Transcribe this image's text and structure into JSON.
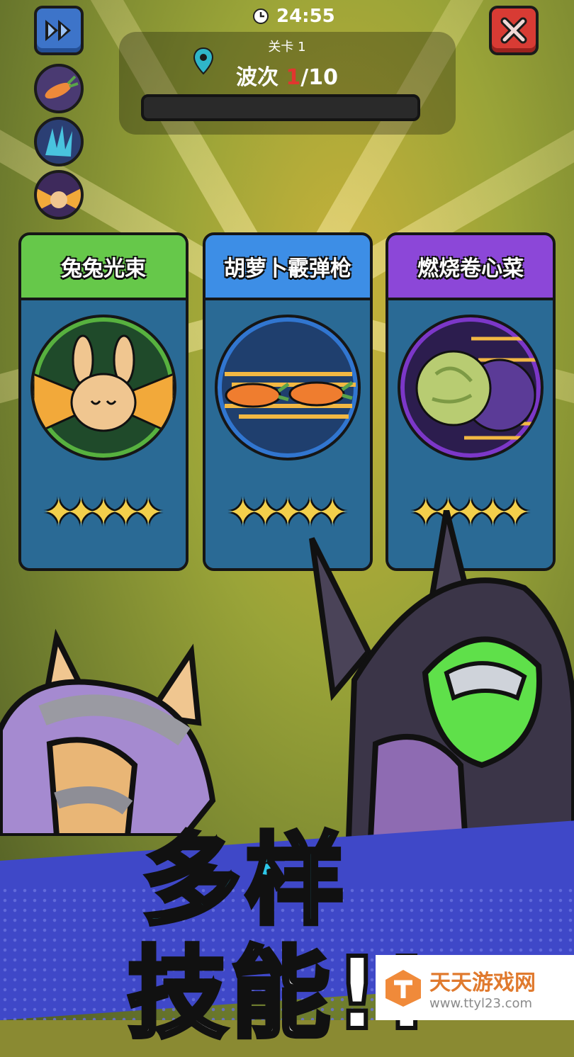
{
  "hud": {
    "timer": "24:55",
    "stage_label": "关卡 1",
    "wave_prefix": "波次 ",
    "wave_current": "1",
    "wave_total": "/10"
  },
  "skills": [
    {
      "name": "兔兔光束",
      "icon": "rabbit-beam-icon",
      "header_color": "#66c84a",
      "ring_color": "#57b13f",
      "stars": 5
    },
    {
      "name": "胡萝卜霰弹枪",
      "icon": "carrot-shotgun-icon",
      "header_color": "#3d8ee6",
      "ring_color": "#3176d0",
      "stars": 5
    },
    {
      "name": "燃烧卷心菜",
      "icon": "burning-cabbage-icon",
      "header_color": "#8c47d8",
      "ring_color": "#7c37c8",
      "stars": 5
    }
  ],
  "banner": {
    "line1": "多样",
    "line2": "技能!!"
  },
  "watermark": {
    "name": "天天游戏网",
    "url": "www.ttyl23.com"
  }
}
